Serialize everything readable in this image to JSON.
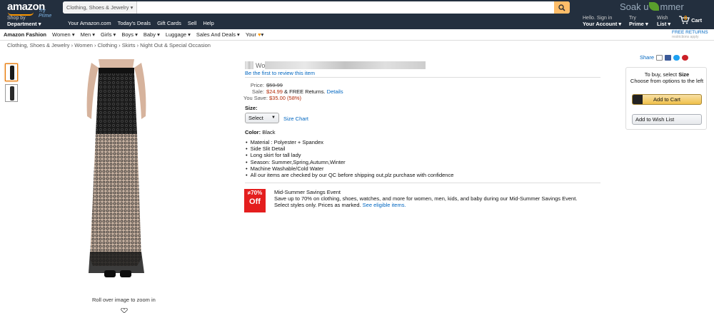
{
  "header": {
    "logo_text": "amazon",
    "logo_sub": "Try Prime",
    "search_category": "Clothing, Shoes & Jewelry",
    "search_placeholder": "",
    "promo_text_1": "Soak u",
    "promo_text_2": "mmer",
    "shop_by_line1": "Shop by",
    "shop_by_line2": "Department",
    "nav_links": [
      "Your Amazon.com",
      "Today's Deals",
      "Gift Cards",
      "Sell",
      "Help"
    ],
    "account_line1": "Hello. Sign in",
    "account_line2": "Your Account",
    "prime_line1": "Try",
    "prime_line2": "Prime",
    "wish_line1": "Wish",
    "wish_line2": "List",
    "cart_count": "0",
    "cart_label": "Cart"
  },
  "subnav": {
    "items": [
      "Amazon Fashion",
      "Women",
      "Men",
      "Girls",
      "Boys",
      "Baby",
      "Luggage",
      "Sales And Deals",
      "Your"
    ],
    "free_returns_1": "FREE RETURNS",
    "free_returns_2": "restrictions apply"
  },
  "breadcrumb": "Clothing, Shoes & Jewelry › Women › Clothing › Skirts › Night Out & Special Occasion",
  "gallery": {
    "zoom_note": "Roll over image to zoom in"
  },
  "product": {
    "title_visible": "Wo",
    "review_link": "Be the first to review this item",
    "price_label": "Price:",
    "price_value": "$59.99",
    "sale_label": "Sale:",
    "sale_value": "$24.99",
    "sale_extra": "& FREE Returns.",
    "details_link": "Details",
    "save_label": "You Save:",
    "save_value": "$35.00 (58%)",
    "size_label": "Size:",
    "size_select": "Select",
    "size_chart": "Size Chart",
    "color_label": "Color:",
    "color_value": "Black",
    "bullets": [
      "Material : Polyester + Spandex",
      "Side Slit Detail",
      "Long skirt for tall lady",
      "Season: Summer,Spring,Autumn,Winter",
      "Machine Washable/Cold Water",
      "All our items are checked by our QC before shipping out,plz purchase with confidence"
    ]
  },
  "event": {
    "badge_pct": "70%",
    "badge_off": "Off",
    "title": "Mid-Summer Savings Event",
    "line1": "Save up to 70% on clothing, shoes, watches, and more for women, men, kids, and baby during our Mid-Summer Savings Event.",
    "line2_text": "Select styles only. Prices as marked.",
    "line2_link": "See eligible items."
  },
  "buybox": {
    "share_label": "Share",
    "instruction_1": "To buy, select",
    "instruction_bold": "Size",
    "instruction_2": "Choose from options to the left",
    "add_to_cart": "Add to Cart",
    "add_to_wishlist": "Add to Wish List"
  },
  "colors": {
    "header_bg": "#232f3e",
    "accent": "#f90",
    "link": "#0066c0",
    "price_red": "#b12704",
    "badge_red": "#e41e1e"
  }
}
